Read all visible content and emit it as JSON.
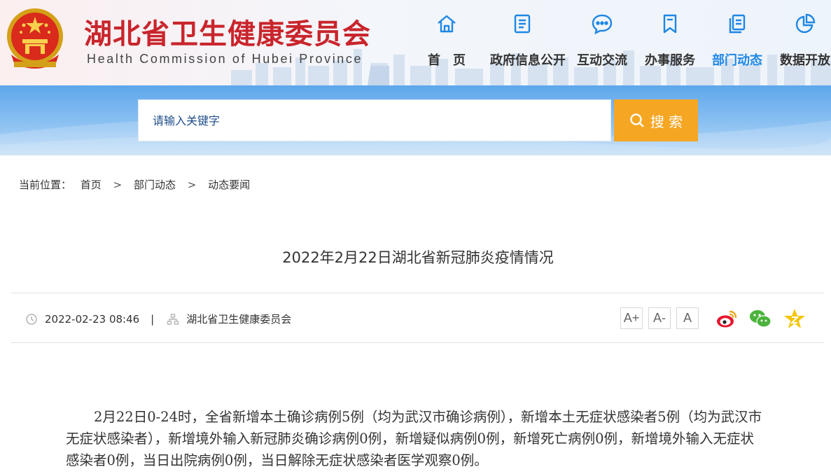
{
  "header": {
    "title": "湖北省卫生健康委员会",
    "subtitle": "Health Commission of Hubei Province",
    "nav": [
      {
        "label": "首　页",
        "icon": "home-icon"
      },
      {
        "label": "政府信息公开",
        "icon": "document-list-icon"
      },
      {
        "label": "互动交流",
        "icon": "chat-bubble-icon"
      },
      {
        "label": "办事服务",
        "icon": "bookmark-icon"
      },
      {
        "label": "部门动态",
        "icon": "copy-pages-icon",
        "active": true
      },
      {
        "label": "数据开放",
        "icon": "pie-chart-icon"
      }
    ],
    "colors": {
      "title": "#c9252c",
      "nav_active": "#1e87e5"
    }
  },
  "search": {
    "placeholder": "请输入关键字",
    "button_label": "搜 索",
    "button_color": "#f5a623"
  },
  "breadcrumb": {
    "prefix": "当前位置：",
    "items": [
      "首页",
      "部门动态",
      "动态要闻"
    ],
    "separator": ">"
  },
  "article": {
    "title": "2022年2月22日湖北省新冠肺炎疫情情况",
    "datetime": "2022-02-23 08:46",
    "meta_divider": "|",
    "source": "湖北省卫生健康委员会",
    "font_sizes": [
      "A+",
      "A-",
      "A"
    ],
    "share": [
      "weibo-icon",
      "wechat-icon",
      "favorite-icon"
    ],
    "body": "2月22日0-24时，全省新增本土确诊病例5例（均为武汉市确诊病例），新增本土无症状感染者5例（均为武汉市无症状感染者），新增境外输入新冠肺炎确诊病例0例，新增疑似病例0例，新增死亡病例0例，新增境外输入无症状感染者0例，当日出院病例0例，当日解除无症状感染者医学观察0例。"
  }
}
